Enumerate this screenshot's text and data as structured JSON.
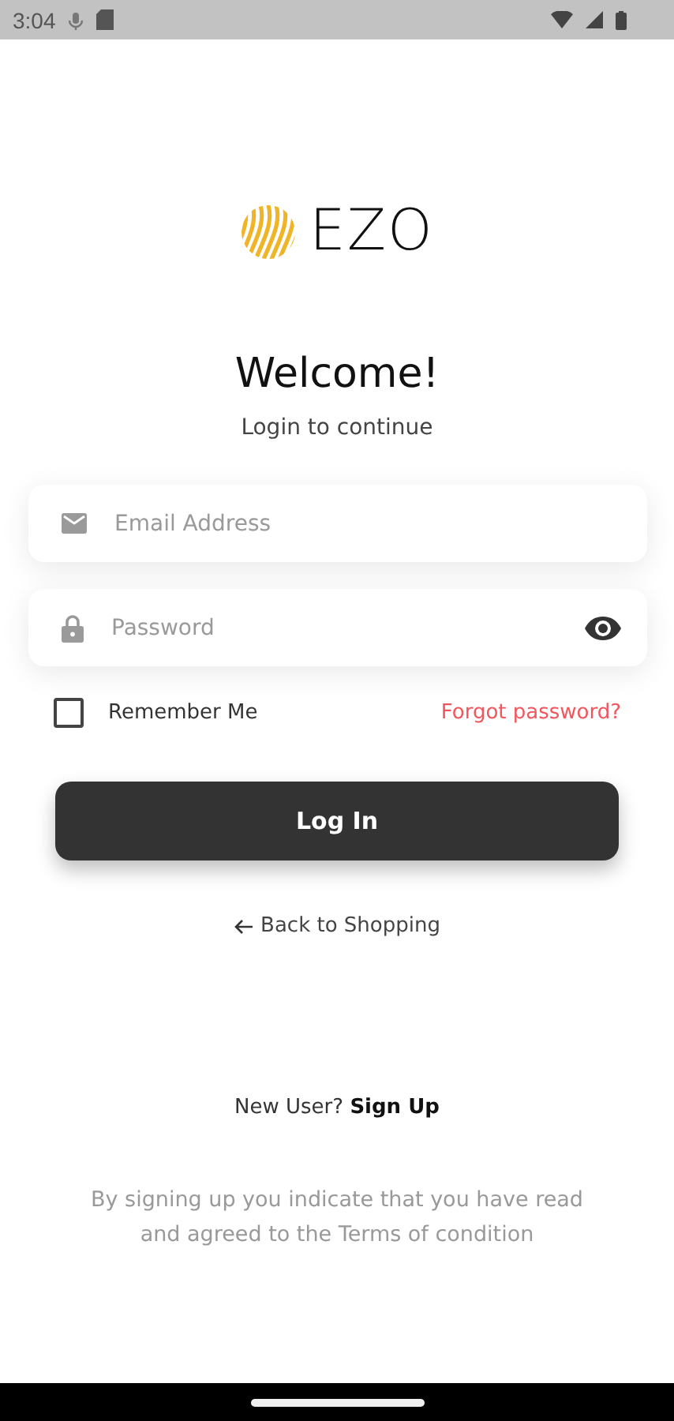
{
  "status_bar": {
    "time": "3:04"
  },
  "logo": {
    "text": "EZO"
  },
  "title": "Welcome!",
  "subtitle": "Login to continue",
  "email": {
    "placeholder": "Email Address"
  },
  "password": {
    "placeholder": "Password"
  },
  "remember": {
    "label": "Remember Me",
    "checked": false
  },
  "forgot_link": "Forgot password?",
  "login_button": "Log In",
  "back_link": "Back to Shopping",
  "signup": {
    "prompt": "New User?",
    "link": "Sign Up"
  },
  "terms": "By signing up you indicate that you have read and agreed to the Terms of condition"
}
